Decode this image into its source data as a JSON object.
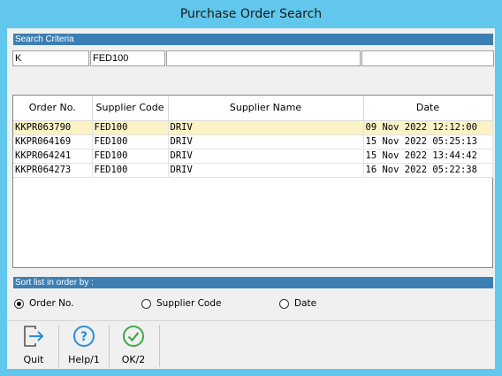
{
  "window": {
    "title": "Purchase Order Search"
  },
  "criteria": {
    "header": "Search Criteria",
    "fields": [
      "K",
      "FED100",
      "",
      ""
    ]
  },
  "grid": {
    "columns": [
      "Order No.",
      "Supplier Code",
      "Supplier Name",
      "Date"
    ],
    "rows": [
      [
        "KKPR063790",
        "FED100",
        "DRIV",
        "09 Nov 2022 12:12:00"
      ],
      [
        "KKPR064169",
        "FED100",
        "DRIV",
        "15 Nov 2022 05:25:13"
      ],
      [
        "KKPR064241",
        "FED100",
        "DRIV",
        "15 Nov 2022 13:44:42"
      ],
      [
        "KKPR064273",
        "FED100",
        "DRIV",
        "16 Nov 2022 05:22:38"
      ]
    ],
    "selected_row": 0,
    "selected_row_color": "#fbf3c5"
  },
  "sort": {
    "header": "Sort list in order by :",
    "options": [
      "Order No.",
      "Supplier Code",
      "Date"
    ],
    "selected": "Order No."
  },
  "toolbar": {
    "quit_label": "Quit",
    "quit_icon": "exit-door-arrow-icon",
    "help_label": "Help/1",
    "help_icon": "question-circle-icon",
    "ok_label": "OK/2",
    "ok_icon": "check-circle-icon"
  },
  "colors": {
    "title_bar": "#61c7ec",
    "section_bar": "#3c7fb4",
    "help_icon": "#2a8fd8",
    "ok_icon": "#3fa845"
  }
}
